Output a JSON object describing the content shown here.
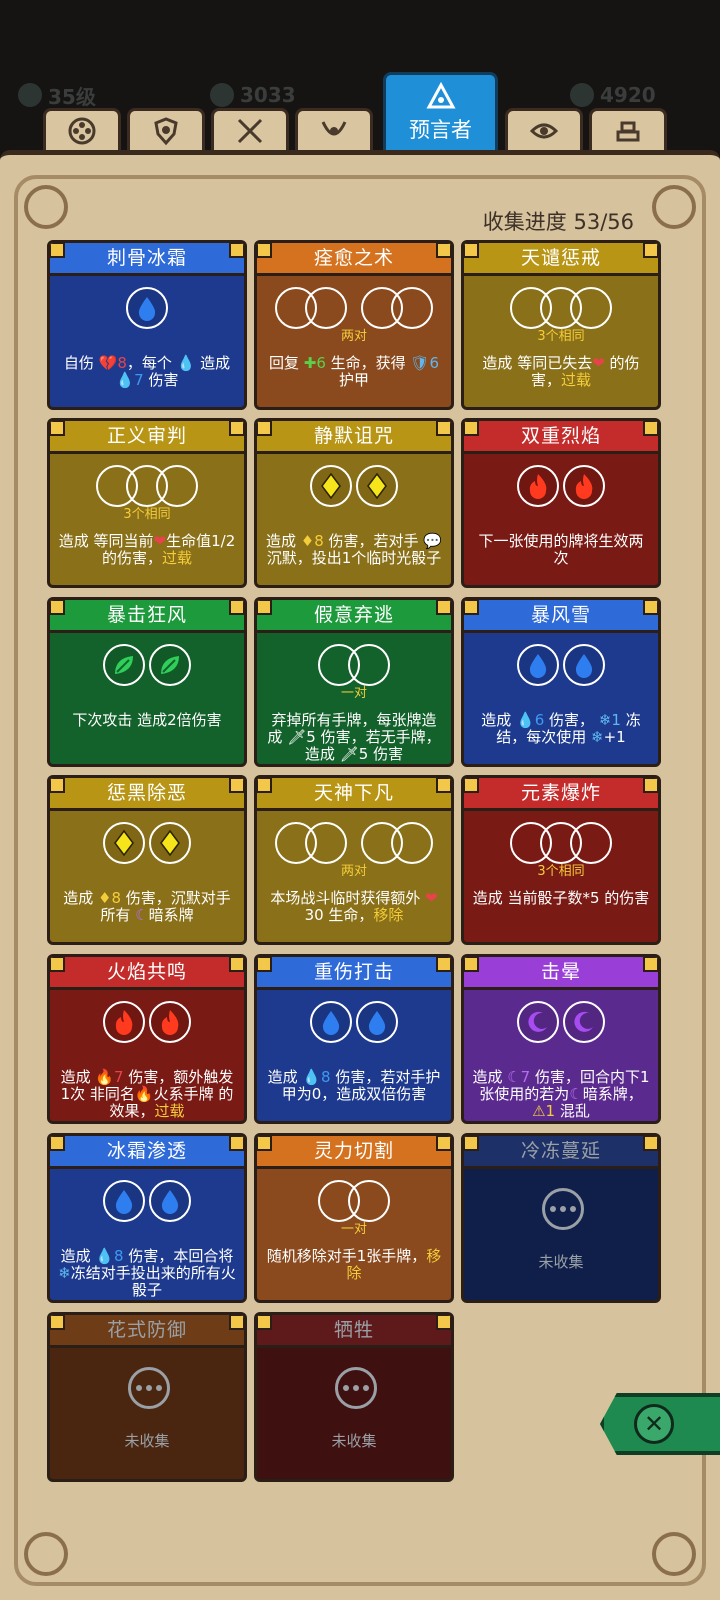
{
  "header": {
    "stats": [
      {
        "icon": "level-icon",
        "value": "35级"
      },
      {
        "icon": "crystal-icon",
        "value": "3033"
      },
      {
        "icon": "gem-icon",
        "value": "4920"
      }
    ],
    "tabs": [
      {
        "icon": "clover-emblem-icon"
      },
      {
        "icon": "shield-emblem-icon"
      },
      {
        "icon": "crossed-swords-icon"
      },
      {
        "icon": "horns-emblem-icon"
      },
      {
        "icon": "triangle-eye-icon",
        "label": "预言者",
        "active": true
      },
      {
        "icon": "eye-emblem-icon"
      },
      {
        "icon": "gold-bars-icon"
      }
    ]
  },
  "progress": {
    "label": "收集进度 53/56"
  },
  "cards": [
    {
      "title": "刺骨冰霜",
      "color": "blue",
      "dice": "single-water",
      "req": "",
      "desc_html": "自伤 <span class='red'>💔8</span>，每个 <span class='blue'>💧</span> 造成 <span class='blue'>💧7</span> 伤害"
    },
    {
      "title": "痊愈之术",
      "color": "orange",
      "dice": "two-pairs",
      "req": "两对",
      "desc_html": "回复 <span class='green'>✚6</span> 生命，获得 <span class='cyan'>🛡6</span> 护甲"
    },
    {
      "title": "天谴惩戒",
      "color": "gold",
      "dice": "triple",
      "req": "3个相同",
      "desc_html": "造成 等同已失去<span class='red'>❤</span> 的伤害，<span class='accent'>过载</span>"
    },
    {
      "title": "正义审判",
      "color": "gold",
      "dice": "triple",
      "req": "3个相同",
      "desc_html": "造成 等同当前<span class='red'>❤</span>生命值1/2的伤害，<span class='accent'>过载</span>"
    },
    {
      "title": "静默诅咒",
      "color": "gold",
      "dice": "two-diamond",
      "req": "",
      "desc_html": "造成 <span class='accent'>♦8</span> 伤害，若对手 <span class='cyan'>💬</span>沉默，投出1个临时光骰子"
    },
    {
      "title": "双重烈焰",
      "color": "red",
      "dice": "two-fire",
      "req": "",
      "desc_html": "下一张使用的牌将生效两次"
    },
    {
      "title": "暴击狂风",
      "color": "green",
      "dice": "two-leaf",
      "req": "",
      "desc_html": "下次攻击 造成2倍伤害"
    },
    {
      "title": "假意弃逃",
      "color": "green",
      "dice": "pair",
      "req": "一对",
      "desc_html": "弃掉所有手牌，每张牌造成 <span>🗡5</span> 伤害，若无手牌，造成 <span>🗡5</span> 伤害"
    },
    {
      "title": "暴风雪",
      "color": "blue",
      "dice": "two-water",
      "req": "",
      "desc_html": "造成 <span class='blue'>💧6</span> 伤害， <span class='cyan'>❄1</span> 冻结，每次使用 <span class='cyan'>❄</span>+1"
    },
    {
      "title": "惩黑除恶",
      "color": "gold",
      "dice": "two-diamond",
      "req": "",
      "desc_html": "造成 <span class='accent'>♦8</span> 伤害，沉默对手所有 <span class='purple'>☾</span>暗系牌"
    },
    {
      "title": "天神下凡",
      "color": "gold",
      "dice": "two-pairs",
      "req": "两对",
      "desc_html": "本场战斗临时获得额外 <span class='red'>❤</span>30 生命，<span class='accent'>移除</span>"
    },
    {
      "title": "元素爆炸",
      "color": "red",
      "dice": "triple",
      "req": "3个相同",
      "desc_html": "造成 当前骰子数*5 的伤害"
    },
    {
      "title": "火焰共鸣",
      "color": "red",
      "dice": "two-fire",
      "req": "",
      "desc_html": "造成 <span class='red'>🔥7</span> 伤害，额外触发1次 非同名<span class='red'>🔥</span>火系手牌 的效果，<span class='accent'>过载</span>"
    },
    {
      "title": "重伤打击",
      "color": "blue",
      "dice": "two-water",
      "req": "",
      "desc_html": "造成 <span class='blue'>💧8</span> 伤害，若对手护甲为0，造成双倍伤害"
    },
    {
      "title": "击晕",
      "color": "purple",
      "dice": "two-moon",
      "req": "",
      "desc_html": "造成 <span class='purple'>☾7</span> 伤害，回合内下1张使用的若为<span class='purple'>☾</span>暗系牌，<span class='accent'>⚠1</span> 混乱"
    },
    {
      "title": "冰霜渗透",
      "color": "blue",
      "dice": "two-water",
      "req": "",
      "desc_html": "造成 <span class='blue'>💧8</span> 伤害，本回合将<span class='cyan'>❄</span>冻结对手投出来的所有火骰子"
    },
    {
      "title": "灵力切割",
      "color": "orange",
      "dice": "pair",
      "req": "一对",
      "desc_html": "随机移除对手1张手牌，<span class='accent'>移除</span>"
    },
    {
      "title": "冷冻蔓延",
      "color": "navy-lock",
      "locked": true,
      "desc_html": "未收集"
    },
    {
      "title": "花式防御",
      "color": "brown-lock",
      "locked": true,
      "desc_html": "未收集"
    },
    {
      "title": "牺牲",
      "color": "maroon-lock",
      "locked": true,
      "desc_html": "未收集"
    }
  ]
}
